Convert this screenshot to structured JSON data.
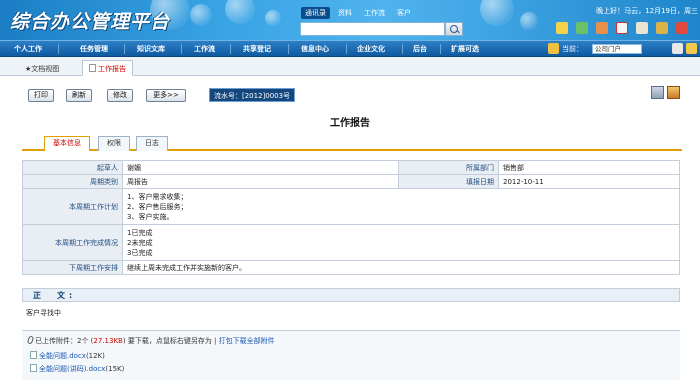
{
  "header": {
    "logo_text": "综合办公管理平台",
    "search_tabs": [
      "通讯录",
      "资料",
      "工作流",
      "客户"
    ],
    "search_tab_active": 0,
    "greeting": "晚上好！马云，12月19日，周三"
  },
  "nav": {
    "items": [
      "个人工作",
      "任务管理",
      "知识文库",
      "工作流",
      "共享登记",
      "信息中心",
      "企业文化",
      "后台",
      "扩展可选"
    ],
    "current_label": "当前：",
    "portal_select": "公司门户"
  },
  "doc_tabs": [
    "文档视图",
    "工作报告"
  ],
  "toolbar": {
    "print": "打印",
    "refresh": "刷新",
    "edit": "修改",
    "more": "更多>>",
    "serial": "流水号：[2012]0003号"
  },
  "page_title": "工作报告",
  "sub_tabs": [
    "基本信息",
    "权限",
    "日志"
  ],
  "form": {
    "drafter_label": "起草人",
    "drafter": "谢媚",
    "dept_label": "所属部门",
    "dept": "销售部",
    "period_type_label": "周期类别",
    "period_type": "周报告",
    "date_label": "填报日期",
    "date": "2012-10-11",
    "plan_label": "本周期工作计划",
    "plan_lines": [
      "1、客户需求收集；",
      "2、客户售后服务；",
      "3、客户实施。"
    ],
    "status_label": "本周期工作完成情况",
    "status_lines": [
      "1已完成",
      "2未完成",
      "3已完成"
    ],
    "next_label": "下周期工作安排",
    "next": "继续上周未完成工作并实施新的客户。"
  },
  "body": {
    "label": "正　文:",
    "text": "客户寻找中"
  },
  "attachments": {
    "head_prefix": "已上传附件：2个 (",
    "head_size": "27.13KB",
    "head_suffix": ") 要下载，点鼠标右键另存为 | ",
    "download_all": "打包下载全部附件",
    "files": [
      {
        "name": "全能问题.docx",
        "size": "(12K)"
      },
      {
        "name": "全能问题(讲码).docx",
        "size": "(15K)"
      }
    ]
  },
  "colors": {
    "banner": "#2e8fd6",
    "nav": "#1766ad",
    "accent_tab": "#e0a000",
    "serial_bg": "#13477d",
    "label_bg": "#e9eef5"
  }
}
